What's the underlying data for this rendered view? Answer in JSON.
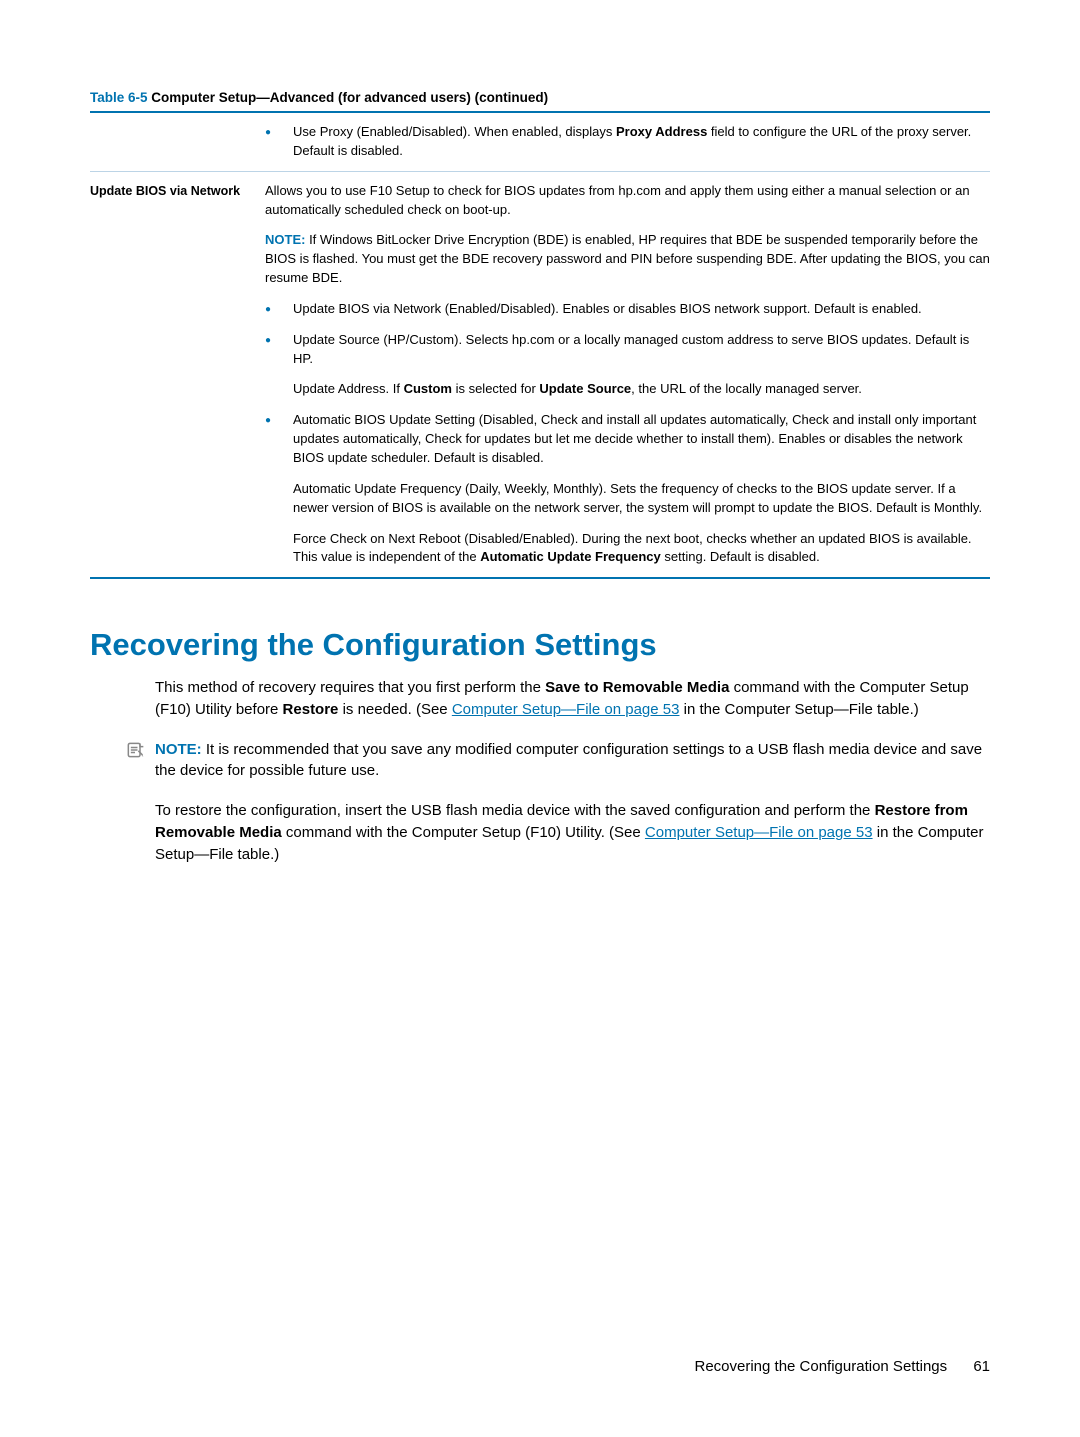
{
  "table": {
    "title_accent": "Table 6-5",
    "title_rest": "  Computer Setup—Advanced (for advanced users) (continued)",
    "row1": {
      "bullet": "Use Proxy (Enabled/Disabled). When enabled, displays ",
      "bullet_bold": "Proxy Address",
      "bullet_tail": " field to configure the URL of the proxy server. Default is disabled."
    },
    "row2": {
      "heading": "Update BIOS via Network",
      "intro": "Allows you to use F10 Setup to check for BIOS updates from hp.com and apply them using either a manual selection or an automatically scheduled check on boot-up.",
      "note_label": "NOTE:",
      "note_body": "   If Windows BitLocker Drive Encryption (BDE) is enabled, HP requires that BDE be suspended temporarily before the BIOS is flashed. You must get the BDE recovery password and PIN before suspending BDE. After updating the BIOS, you can resume BDE.",
      "b1": "Update BIOS via Network (Enabled/Disabled). Enables or disables BIOS network support. Default is enabled.",
      "b2": "Update Source (HP/Custom). Selects hp.com or a locally managed custom address to serve BIOS updates. Default is HP.",
      "b2_sub_pre": "Update Address. If ",
      "b2_sub_bold1": "Custom",
      "b2_sub_mid": " is selected for ",
      "b2_sub_bold2": "Update Source",
      "b2_sub_post": ", the URL of the locally managed server.",
      "b3": "Automatic BIOS Update Setting (Disabled, Check and install all updates automatically, Check and install only important updates automatically, Check for updates but let me decide whether to install them). Enables or disables the network BIOS update scheduler. Default is disabled.",
      "b3_sub": "Automatic Update Frequency (Daily, Weekly, Monthly). Sets the frequency of checks to the BIOS update server. If a newer version of BIOS is available on the network server, the system will prompt to update the BIOS. Default is Monthly.",
      "b3_sub2_pre": "Force Check on Next Reboot (Disabled/Enabled). During the next boot, checks whether an updated BIOS is available. This value is independent of the ",
      "b3_sub2_bold": "Automatic Update Frequency",
      "b3_sub2_post": " setting. Default is disabled."
    }
  },
  "section": {
    "heading": "Recovering the Configuration Settings",
    "p1_pre": "This method of recovery requires that you first perform the ",
    "p1_bold1": "Save to Removable Media",
    "p1_mid": " command with the Computer Setup (F10) Utility before ",
    "p1_bold2": "Restore",
    "p1_post": " is needed. (See ",
    "p1_link": "Computer Setup—File on page 53",
    "p1_tail": " in the Computer Setup—File table.)",
    "note_label": "NOTE:",
    "note_body": "   It is recommended that you save any modified computer configuration settings to a USB flash media device and save the device for possible future use.",
    "p2_pre": "To restore the configuration, insert the USB flash media device with the saved configuration and perform the ",
    "p2_bold": "Restore from Removable Media",
    "p2_mid": " command with the Computer Setup (F10) Utility. (See ",
    "p2_link": "Computer Setup—File on page 53",
    "p2_tail": " in the Computer Setup—File table.)"
  },
  "footer": {
    "text": "Recovering the Configuration Settings",
    "page": "61"
  }
}
